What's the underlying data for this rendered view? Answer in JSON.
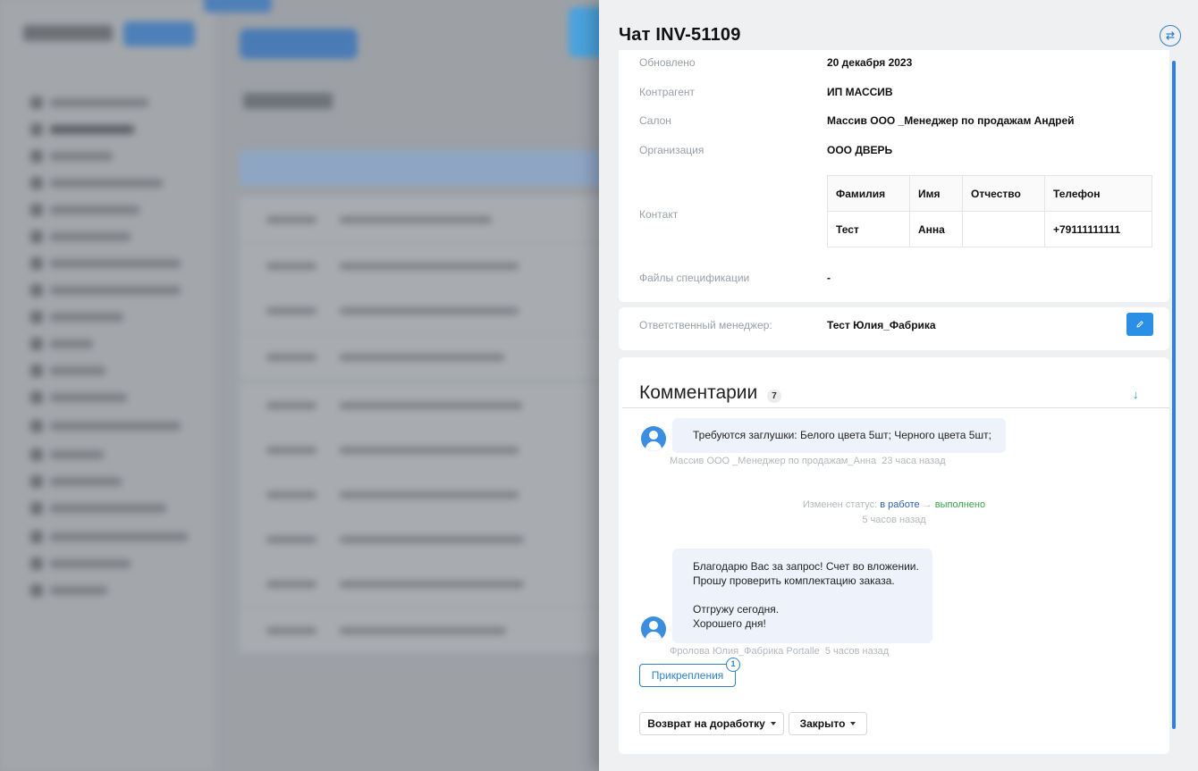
{
  "drawer": {
    "title": "Чат INV-51109"
  },
  "info": {
    "updated_label": "Обновлено",
    "updated_value": "20 декабря 2023",
    "counterparty_label": "Контрагент",
    "counterparty_value": "ИП МАССИВ",
    "salon_label": "Салон",
    "salon_value": "Массив ООО _Менеджер по продажам Андрей",
    "organization_label": "Организация",
    "organization_value": "ООО ДВЕРЬ",
    "contact_label": "Контакт",
    "contact_table": {
      "headers": [
        "Фамилия",
        "Имя",
        "Отчество",
        "Телефон"
      ],
      "row": [
        "Тест",
        "Анна",
        "",
        "+79111111111"
      ]
    },
    "spec_files_label": "Файлы спецификации",
    "spec_files_value": "-"
  },
  "manager": {
    "label": "Ответственный менеджер:",
    "value": "Тест Юлия_Фабрика",
    "edit_icon": "pencil-icon"
  },
  "comments": {
    "title": "Комментарии",
    "count": "7",
    "items": [
      {
        "text": "Требуются заглушки: Белого цвета 5шт; Черного цвета 5шт;",
        "author": "Массив ООО _Менеджер по продажам_Анна",
        "time": "23 часа назад"
      },
      {
        "lines": [
          "Благодарю Вас за запрос! Счет во вложении.",
          "Прошу проверить комплектацию заказа.",
          "",
          "Отгружу сегодня.",
          "Хорошего дня!"
        ],
        "author": "Фролова Юлия_Фабрика Portalle",
        "time": "5 часов назад"
      }
    ],
    "status_change": {
      "prefix": "Изменен статус:",
      "from": "в работе",
      "arrow": "→",
      "to": "выполнено",
      "time": "5 часов назад"
    },
    "attachments_label": "Прикрепления",
    "attachments_count": "1"
  },
  "actions": {
    "return_label": "Возврат на доработку",
    "close_label": "Закрыто"
  },
  "colors": {
    "accent": "#2f80c9",
    "status_from": "#2b5fb0",
    "status_to": "#3aa34a"
  }
}
